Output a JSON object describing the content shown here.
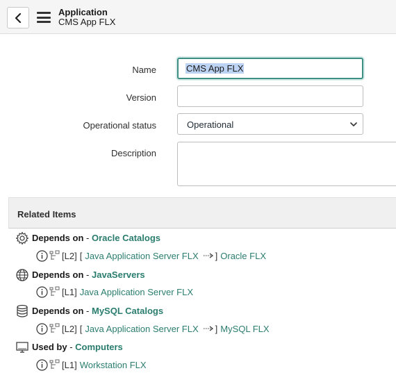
{
  "header": {
    "title": "Application",
    "subtitle": "CMS App FLX"
  },
  "form": {
    "name_label": "Name",
    "name_value": "CMS App FLX",
    "version_label": "Version",
    "version_value": "",
    "status_label": "Operational status",
    "status_value": "Operational",
    "description_label": "Description",
    "description_value": ""
  },
  "related": {
    "title": "Related Items",
    "groups": [
      {
        "relation": "Depends on",
        "separator": "-",
        "target": "Oracle Catalogs",
        "icon": "gear-icon",
        "path": {
          "level": "[L2]",
          "open_bracket": "[",
          "hop": "Java Application Server FLX",
          "close_bracket": "]",
          "end": "Oracle FLX"
        }
      },
      {
        "relation": "Depends on",
        "separator": "-",
        "target": "JavaServers",
        "icon": "globe-icon",
        "path": {
          "level": "[L1]",
          "end": "Java Application Server FLX"
        }
      },
      {
        "relation": "Depends on",
        "separator": "-",
        "target": "MySQL Catalogs",
        "icon": "database-icon",
        "path": {
          "level": "[L2]",
          "open_bracket": "[",
          "hop": "Java Application Server FLX",
          "close_bracket": "]",
          "end": "MySQL FLX"
        }
      },
      {
        "relation": "Used by",
        "separator": "-",
        "target": "Computers",
        "icon": "computer-icon",
        "path": {
          "level": "[L1]",
          "end": "Workstation FLX"
        }
      }
    ]
  },
  "colors": {
    "link": "#2a7d6e",
    "focus_border": "#3d8f83",
    "selection": "#bcd3f3"
  }
}
